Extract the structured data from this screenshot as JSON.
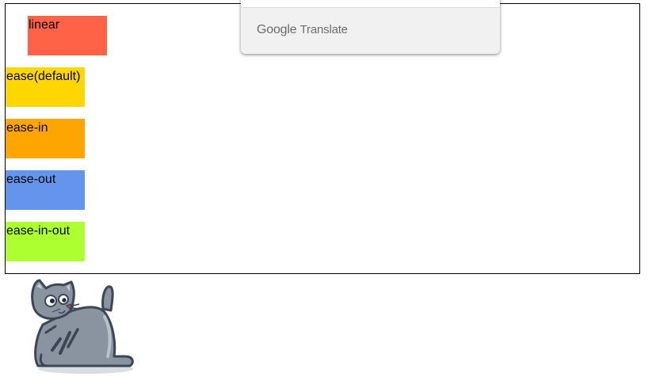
{
  "boxes": [
    {
      "label": "linear",
      "color": "#ff6347"
    },
    {
      "label": "ease(default)",
      "color": "#ffd700"
    },
    {
      "label": "ease-in",
      "color": "#ffa500"
    },
    {
      "label": "ease-out",
      "color": "#6495ed"
    },
    {
      "label": "ease-in-out",
      "color": "#adff2f"
    }
  ],
  "translate_popup": {
    "brand_google": "Google",
    "brand_translate": "Translate"
  },
  "mascot": {
    "icon": "cat-icon",
    "color": "#8a94a0"
  }
}
